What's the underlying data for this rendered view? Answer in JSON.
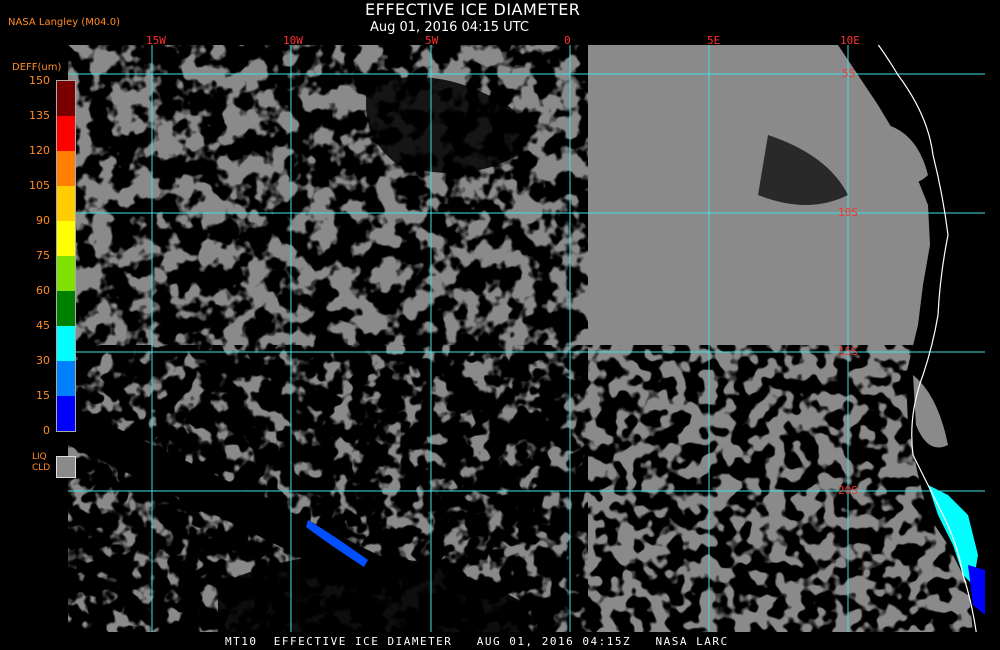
{
  "header": {
    "title": "EFFECTIVE ICE DIAMETER",
    "subtitle": "Aug 01, 2016 04:15 UTC",
    "credit": "NASA Langley (M04.0)"
  },
  "footer": {
    "text": "MT10  EFFECTIVE ICE DIAMETER   AUG 01, 2016 04:15Z   NASA LARC"
  },
  "map": {
    "longitude_labels": [
      "15W",
      "10W",
      "5W",
      "0",
      "5E",
      "10E"
    ],
    "latitude_labels": [
      "5S",
      "10S",
      "15S",
      "20S"
    ],
    "grid_color": "#40e0e0",
    "cloud_color": "#8a8a8a",
    "clear_color": "#000000",
    "coastline_color": "#ffffff"
  },
  "legend": {
    "title": "DEFF(um)",
    "ticks": [
      "150",
      "135",
      "120",
      "105",
      "90",
      "75",
      "60",
      "45",
      "30",
      "15",
      "0"
    ],
    "colors": [
      "#7a0000",
      "#ff0000",
      "#ff8000",
      "#ffcc00",
      "#ffff00",
      "#80e000",
      "#008000",
      "#00ffff",
      "#0080ff",
      "#0000ff",
      "#9933cc"
    ],
    "liquid_label_line1": "LIQ",
    "liquid_label_line2": "CLD",
    "liquid_color": "#8a8a8a"
  }
}
